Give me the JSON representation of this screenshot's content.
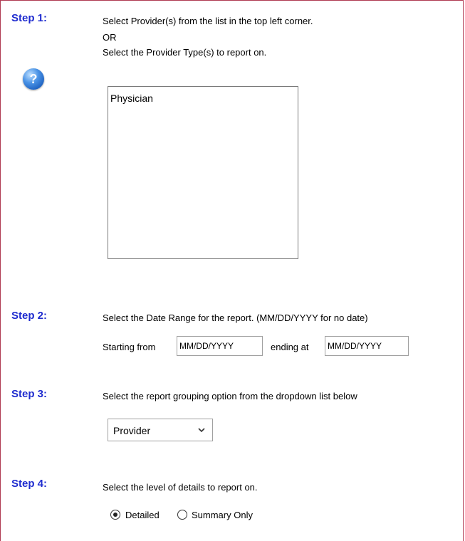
{
  "step1": {
    "label": "Step 1:",
    "line1": "Select Provider(s) from the list in the top left corner.",
    "line2": "OR",
    "line3": "Select the Provider Type(s) to report on.",
    "help_icon": "question-mark-circle",
    "provider_types": [
      "Physician"
    ]
  },
  "step2": {
    "label": "Step 2:",
    "instruction": "Select the Date Range for the report. (MM/DD/YYYY for no date)",
    "starting_label": "Starting from",
    "start_date": "MM/DD/YYYY",
    "ending_label": "ending at",
    "end_date": "MM/DD/YYYY"
  },
  "step3": {
    "label": "Step 3:",
    "instruction": "Select the report grouping option from the dropdown list below",
    "grouping_selected": "Provider"
  },
  "step4": {
    "label": "Step 4:",
    "instruction": "Select the level of details to report on.",
    "options": [
      "Detailed",
      "Summary Only"
    ],
    "selected": "Detailed"
  },
  "colors": {
    "step_label": "#1f2ccf",
    "frame_border": "#b03a52"
  }
}
